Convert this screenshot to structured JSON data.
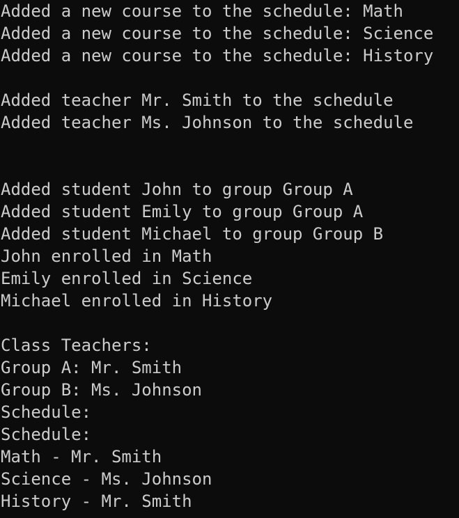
{
  "colors": {
    "background": "#0c0c0c",
    "text": "#cccccc"
  },
  "console": {
    "lines": [
      "Added a new course to the schedule: Math",
      "Added a new course to the schedule: Science",
      "Added a new course to the schedule: History",
      "",
      "Added teacher Mr. Smith to the schedule",
      "Added teacher Ms. Johnson to the schedule",
      "",
      "",
      "Added student John to group Group A",
      "Added student Emily to group Group A",
      "Added student Michael to group Group B",
      "John enrolled in Math",
      "Emily enrolled in Science",
      "Michael enrolled in History",
      "",
      "Class Teachers:",
      "Group A: Mr. Smith",
      "Group B: Ms. Johnson",
      "Schedule:",
      "Schedule:",
      "Math - Mr. Smith",
      "Science - Ms. Johnson",
      "History - Mr. Smith"
    ]
  }
}
